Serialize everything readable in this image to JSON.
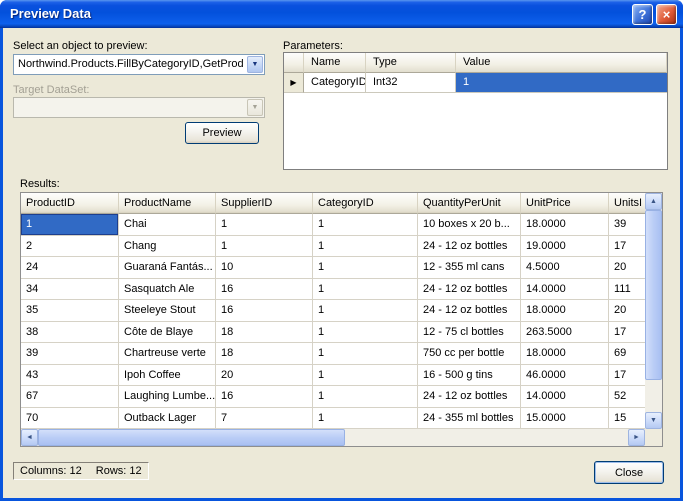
{
  "window": {
    "title": "Preview Data",
    "help_glyph": "?",
    "close_glyph": "×"
  },
  "object_select": {
    "label": "Select an object to preview:",
    "value": "Northwind.Products.FillByCategoryID,GetProd"
  },
  "target_dataset": {
    "label": "Target DataSet:",
    "value": ""
  },
  "buttons": {
    "preview": "Preview",
    "close": "Close"
  },
  "parameters": {
    "label": "Parameters:",
    "columns": [
      "Name",
      "Type",
      "Value"
    ],
    "row": {
      "name": "CategoryID",
      "type": "Int32",
      "value": "1"
    }
  },
  "results": {
    "label": "Results:",
    "columns": [
      "ProductID",
      "ProductName",
      "SupplierID",
      "CategoryID",
      "QuantityPerUnit",
      "UnitPrice",
      "UnitsI"
    ],
    "rows": [
      [
        "1",
        "Chai",
        "1",
        "1",
        "10 boxes x 20 b...",
        "18.0000",
        "39"
      ],
      [
        "2",
        "Chang",
        "1",
        "1",
        "24 - 12 oz bottles",
        "19.0000",
        "17"
      ],
      [
        "24",
        "Guaraná Fantás...",
        "10",
        "1",
        "12 - 355 ml cans",
        "4.5000",
        "20"
      ],
      [
        "34",
        "Sasquatch Ale",
        "16",
        "1",
        "24 - 12 oz bottles",
        "14.0000",
        "111"
      ],
      [
        "35",
        "Steeleye Stout",
        "16",
        "1",
        "24 - 12 oz bottles",
        "18.0000",
        "20"
      ],
      [
        "38",
        "Côte de Blaye",
        "18",
        "1",
        "12 - 75 cl bottles",
        "263.5000",
        "17"
      ],
      [
        "39",
        "Chartreuse verte",
        "18",
        "1",
        "750 cc per bottle",
        "18.0000",
        "69"
      ],
      [
        "43",
        "Ipoh Coffee",
        "20",
        "1",
        "16 - 500 g tins",
        "46.0000",
        "17"
      ],
      [
        "67",
        "Laughing Lumbe...",
        "16",
        "1",
        "24 - 12 oz bottles",
        "14.0000",
        "52"
      ],
      [
        "70",
        "Outback Lager",
        "7",
        "1",
        "24 - 355 ml bottles",
        "15.0000",
        "15"
      ]
    ]
  },
  "status": {
    "columns": "Columns: 12",
    "rows": "Rows: 12"
  },
  "icons": {
    "combo_arrow": "▼",
    "scroll_up": "▲",
    "scroll_down": "▼",
    "scroll_left": "◄",
    "scroll_right": "►",
    "row_indicator": "▶"
  },
  "colors": {
    "selection": "#316AC5",
    "titlebar": "#0054E3",
    "dialog_bg": "#ECE9D8"
  }
}
